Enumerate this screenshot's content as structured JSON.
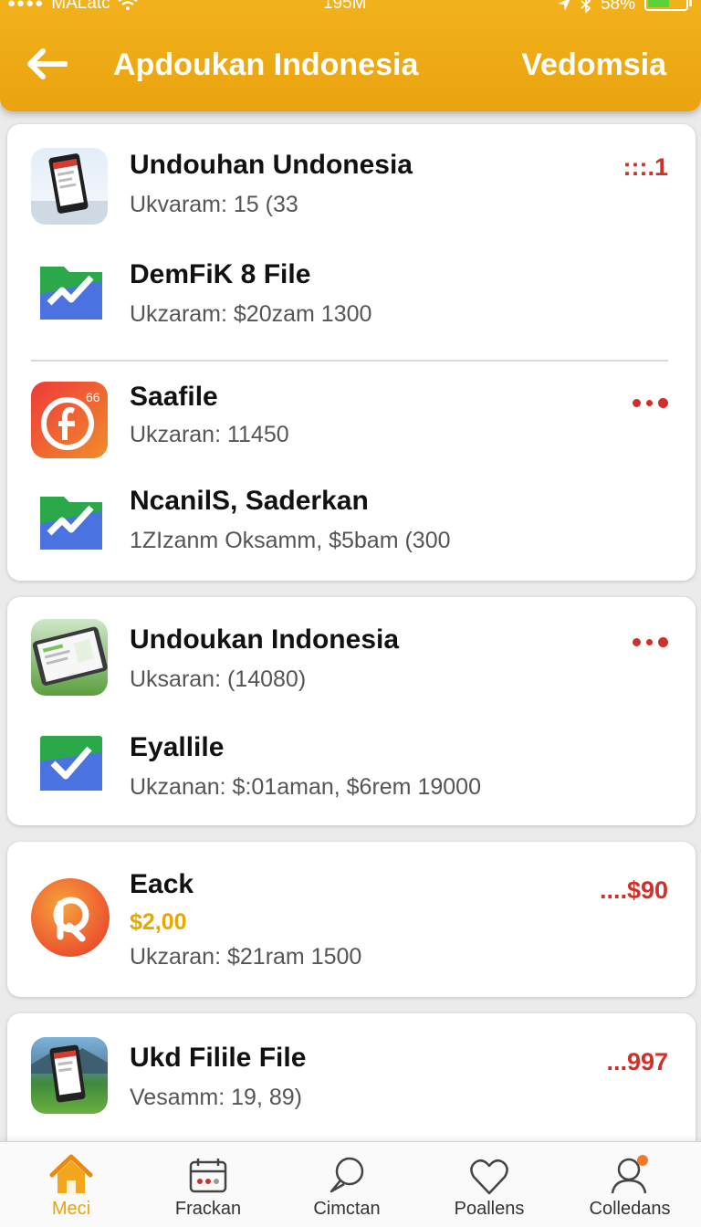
{
  "status_bar": {
    "carrier": "MALatc",
    "time": "195M",
    "battery": "58%",
    "battery_level": 0.58
  },
  "header": {
    "title": "Apdoukan Indonesia",
    "right_text": "Vedomsia"
  },
  "cards": [
    {
      "items": [
        {
          "title": "Undouhan Undonesia",
          "subtitle": "Ukvaram: 15 (33",
          "right_text": ":::.1",
          "icon": "phone-app-icon"
        },
        {
          "title": "DemFiK 8 File",
          "subtitle": "Ukzaram: $20zam 1300",
          "icon": "green-chart-folder-icon"
        }
      ]
    },
    {
      "items": [
        {
          "title": "Saafile",
          "subtitle": "Ukzaran: 11450",
          "menu": "more-dots-icon",
          "icon": "red-f-app-icon"
        },
        {
          "title": "NcanilS, Saderkan",
          "subtitle": "1ZIzanm  Oksamm, $5bam (300",
          "icon": "green-chart-folder-icon"
        }
      ]
    },
    {
      "items": [
        {
          "title": "Undoukan Indonesia",
          "subtitle": "Uksaran: (14080)",
          "menu": "more-dots-icon",
          "icon": "tablet-app-icon"
        },
        {
          "title": "Eyallile",
          "subtitle": "Ukzanan:  $:01aman, $6rem 19000",
          "icon": "green-check-folder-icon"
        }
      ]
    },
    {
      "items": [
        {
          "title": "Eack",
          "price": "$2,00",
          "subtitle": "Ukzaran: $21ram 1500",
          "right_text": "....$90",
          "icon": "red-r-app-icon"
        }
      ]
    },
    {
      "items": [
        {
          "title": "Ukd Filile File",
          "subtitle": "Vesamm: 19, 89)",
          "right_text": "...997",
          "icon": "landscape-phone-icon"
        }
      ]
    }
  ],
  "tabs": [
    {
      "label": "Meci",
      "icon": "home-icon",
      "active": true
    },
    {
      "label": "Frackan",
      "icon": "calendar-icon",
      "active": false
    },
    {
      "label": "Cimctan",
      "icon": "chat-bubble-icon",
      "active": false
    },
    {
      "label": "Poallens",
      "icon": "heart-icon",
      "active": false
    },
    {
      "label": "Colledans",
      "icon": "profile-icon",
      "active": false
    }
  ],
  "colors": {
    "accent": "#eaa30f",
    "alert_red": "#d0302a",
    "price_yellow": "#e5a800",
    "icon_green": "#2aa84a",
    "icon_blue": "#4a72e0"
  }
}
